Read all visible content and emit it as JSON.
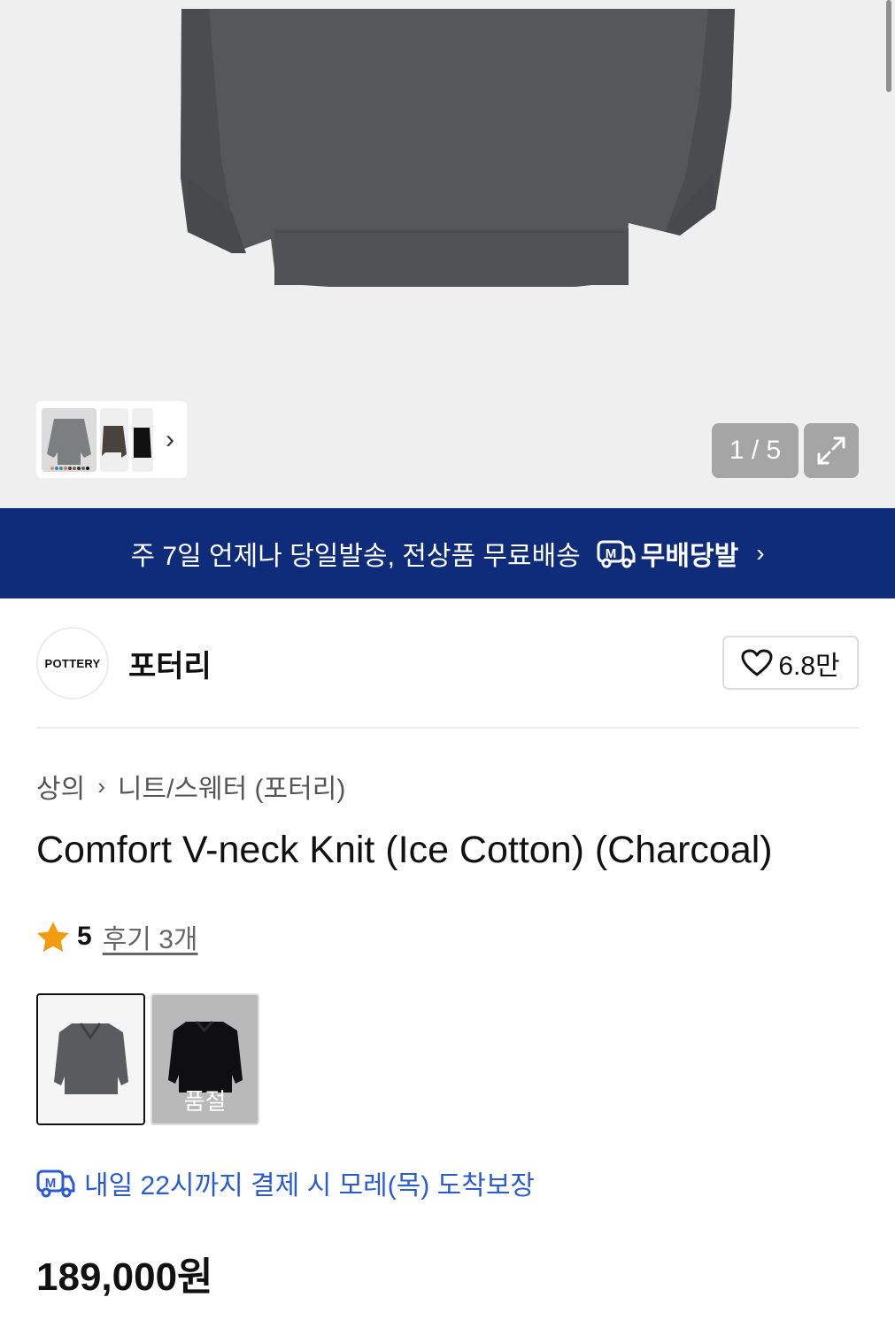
{
  "gallery": {
    "counter": "1 / 5",
    "thumbnails": [
      "gray-sweater-thumb",
      "brown-sweater-thumb",
      "black-sweater-thumb"
    ]
  },
  "banner": {
    "text": "주 7일 언제나 당일발송, 전상품 무료배송",
    "brand": "무배당발",
    "icon_letter": "M"
  },
  "store": {
    "logo_text": "POTTERY",
    "name": "포터리",
    "likes": "6.8만"
  },
  "breadcrumb": {
    "category": "상의",
    "subcategory": "니트/스웨터 (포터리)"
  },
  "product": {
    "title": "Comfort V-neck Knit (Ice Cotton) (Charcoal)",
    "rating": "5",
    "reviews": "후기 3개",
    "price": "189,000원"
  },
  "options": {
    "sold_out_label": "품절"
  },
  "delivery": {
    "text": "내일 22시까지 결제 시 모레(목) 도착보장"
  },
  "colors": {
    "banner_bg": "#0f2c7b",
    "delivery_blue": "#2a5bd7",
    "star": "#f39c12"
  }
}
